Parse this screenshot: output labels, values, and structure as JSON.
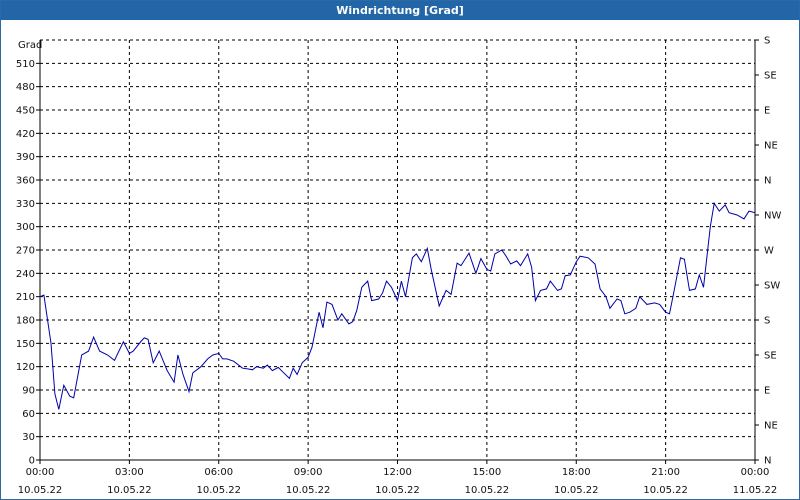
{
  "window": {
    "title": "Windrichtung [Grad]"
  },
  "chart_data": {
    "type": "line",
    "title": "Windrichtung [Grad]",
    "ylabel": "Grad",
    "ylim": [
      0,
      540
    ],
    "xlim_hours": [
      0,
      24
    ],
    "yticks": [
      0,
      30,
      60,
      90,
      120,
      150,
      180,
      210,
      240,
      270,
      300,
      330,
      360,
      390,
      420,
      450,
      480,
      510
    ],
    "right_axis_labels": [
      "N",
      "NE",
      "E",
      "SE",
      "S",
      "SW",
      "W",
      "NW",
      "N",
      "NE",
      "E",
      "SE",
      "S"
    ],
    "right_axis_step": 45,
    "x_ticks": [
      {
        "time": "00:00",
        "date": "10.05.22"
      },
      {
        "time": "03:00",
        "date": "10.05.22"
      },
      {
        "time": "06:00",
        "date": "10.05.22"
      },
      {
        "time": "09:00",
        "date": "10.05.22"
      },
      {
        "time": "12:00",
        "date": "10.05.22"
      },
      {
        "time": "15:00",
        "date": "10.05.22"
      },
      {
        "time": "18:00",
        "date": "10.05.22"
      },
      {
        "time": "21:00",
        "date": "10.05.22"
      },
      {
        "time": "00:00",
        "date": "11.05.22"
      }
    ],
    "grid": true,
    "series": [
      {
        "color": "#0000aa",
        "x": [
          0,
          0.13,
          0.37,
          0.5,
          0.63,
          0.8,
          1,
          1.13,
          1.4,
          1.63,
          1.8,
          2,
          2.27,
          2.5,
          2.8,
          3,
          3.13,
          3.4,
          3.5,
          3.63,
          3.8,
          4,
          4.13,
          4.27,
          4.5,
          4.63,
          4.8,
          5,
          5.13,
          5.4,
          5.63,
          5.8,
          6,
          6.13,
          6.27,
          6.5,
          6.8,
          7,
          7.13,
          7.27,
          7.5,
          7.63,
          7.8,
          8,
          8.13,
          8.37,
          8.5,
          8.63,
          8.8,
          9,
          9.13,
          9.37,
          9.5,
          9.63,
          9.8,
          10,
          10.13,
          10.37,
          10.5,
          10.63,
          10.8,
          11,
          11.13,
          11.37,
          11.5,
          11.63,
          11.8,
          12,
          12.13,
          12.27,
          12.5,
          12.63,
          12.8,
          13,
          13.13,
          13.4,
          13.63,
          13.8,
          14,
          14.13,
          14.4,
          14.63,
          14.8,
          15,
          15.13,
          15.27,
          15.5,
          15.63,
          15.8,
          16,
          16.13,
          16.37,
          16.5,
          16.63,
          16.8,
          17,
          17.13,
          17.37,
          17.5,
          17.63,
          17.8,
          18,
          18.13,
          18.4,
          18.63,
          18.8,
          19,
          19.13,
          19.37,
          19.5,
          19.63,
          19.8,
          20,
          20.13,
          20.37,
          20.63,
          20.8,
          21,
          21.13,
          21.27,
          21.5,
          21.63,
          21.8,
          22,
          22.13,
          22.27,
          22.5,
          22.63,
          22.8,
          23,
          23.13,
          23.4,
          23.63,
          23.8,
          24
        ],
        "y": [
          210,
          212,
          150,
          85,
          65,
          96,
          82,
          80,
          135,
          140,
          158,
          140,
          135,
          128,
          152,
          137,
          140,
          153,
          157,
          155,
          125,
          140,
          128,
          115,
          100,
          135,
          110,
          88,
          112,
          120,
          130,
          135,
          137,
          130,
          130,
          127,
          118,
          117,
          116,
          120,
          118,
          122,
          115,
          119,
          114,
          105,
          118,
          110,
          125,
          132,
          145,
          190,
          170,
          203,
          200,
          180,
          188,
          175,
          178,
          192,
          222,
          230,
          205,
          207,
          215,
          230,
          222,
          205,
          230,
          210,
          260,
          265,
          255,
          272,
          245,
          198,
          218,
          213,
          253,
          250,
          266,
          240,
          259,
          245,
          243,
          265,
          270,
          263,
          252,
          256,
          250,
          265,
          248,
          205,
          218,
          220,
          230,
          218,
          220,
          237,
          238,
          255,
          262,
          260,
          252,
          220,
          210,
          195,
          207,
          205,
          188,
          190,
          195,
          210,
          200,
          202,
          200,
          190,
          188,
          215,
          260,
          258,
          218,
          220,
          238,
          222,
          300,
          330,
          320,
          328,
          318,
          315,
          310,
          320,
          318
        ]
      }
    ]
  }
}
